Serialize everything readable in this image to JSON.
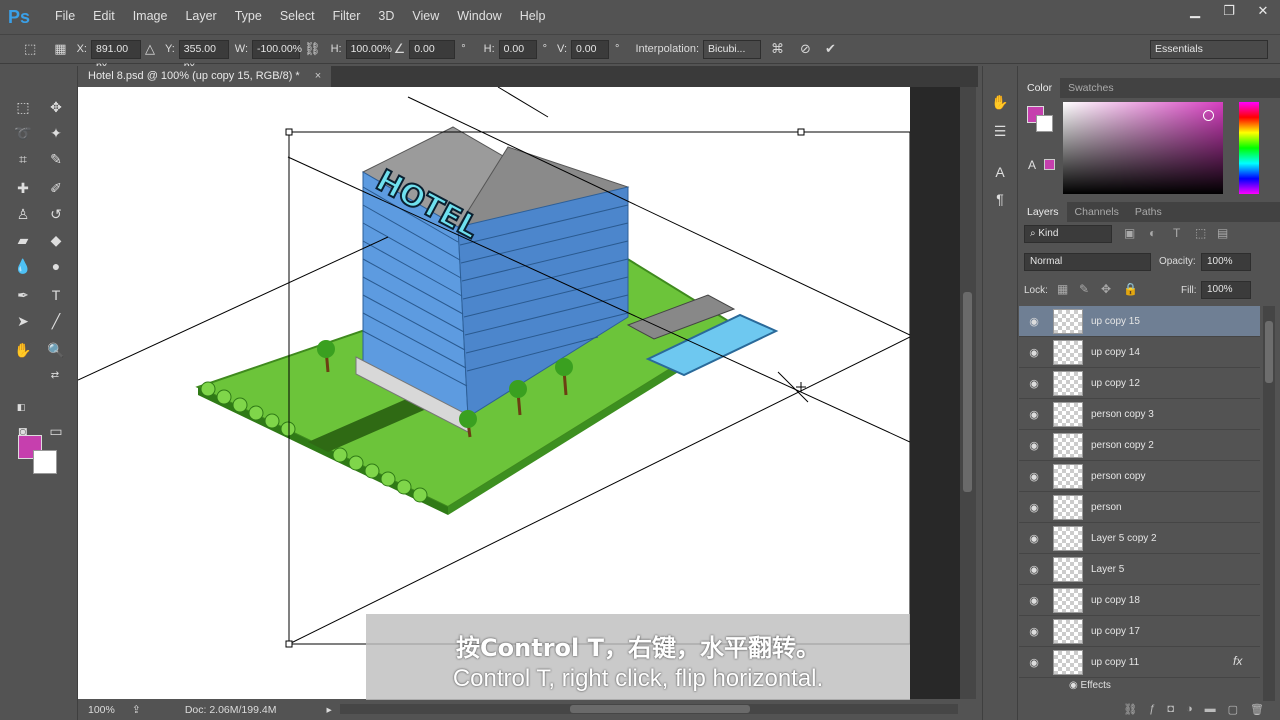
{
  "app": {
    "logo": "Ps",
    "menu": [
      "File",
      "Edit",
      "Image",
      "Layer",
      "Type",
      "Select",
      "Filter",
      "3D",
      "View",
      "Window",
      "Help"
    ],
    "window_controls": [
      "minimize",
      "restore",
      "close"
    ]
  },
  "options": {
    "x_label": "X:",
    "x_value": "891.00 px",
    "y_label": "Y:",
    "y_value": "355.00 px",
    "w_label": "W:",
    "w_value": "-100.00%",
    "h_label": "H:",
    "h_value": "100.00%",
    "angle_value": "0.00",
    "angle_unit": "°",
    "hskew_label": "H:",
    "hskew_value": "0.00",
    "hskew_unit": "°",
    "vskew_label": "V:",
    "vskew_value": "0.00",
    "vskew_unit": "°",
    "interp_label": "Interpolation:",
    "interp_value": "Bicubi...",
    "workspace": "Essentials"
  },
  "document": {
    "tab_title": "Hotel 8.psd @ 100% (up copy 15, RGB/8) *",
    "close_glyph": "×",
    "artwork_sign": "HOTEL"
  },
  "status": {
    "zoom": "100%",
    "doc_size": "Doc: 2.06M/199.4M"
  },
  "subtitle": {
    "cn": "按Control T，右键，水平翻转。",
    "en": "Control T, right click, flip horizontal."
  },
  "color_panel": {
    "tabs": [
      "Color",
      "Swatches"
    ],
    "fg": "#c63fae",
    "bg": "#ffffff"
  },
  "layers_panel": {
    "tabs": [
      "Layers",
      "Channels",
      "Paths"
    ],
    "filter_kind": "Kind",
    "blend_mode": "Normal",
    "opacity_label": "Opacity:",
    "opacity_value": "100%",
    "lock_label": "Lock:",
    "fill_label": "Fill:",
    "fill_value": "100%",
    "layers": [
      "up copy 15",
      "up copy 14",
      "up copy 12",
      "person copy 3",
      "person copy 2",
      "person copy",
      "person",
      "Layer 5 copy 2",
      "Layer 5",
      "up copy 18",
      "up copy 17",
      "up copy 11"
    ],
    "selected_layer": "up copy 15",
    "fx_label": "fx",
    "effects_label": "Effects"
  }
}
